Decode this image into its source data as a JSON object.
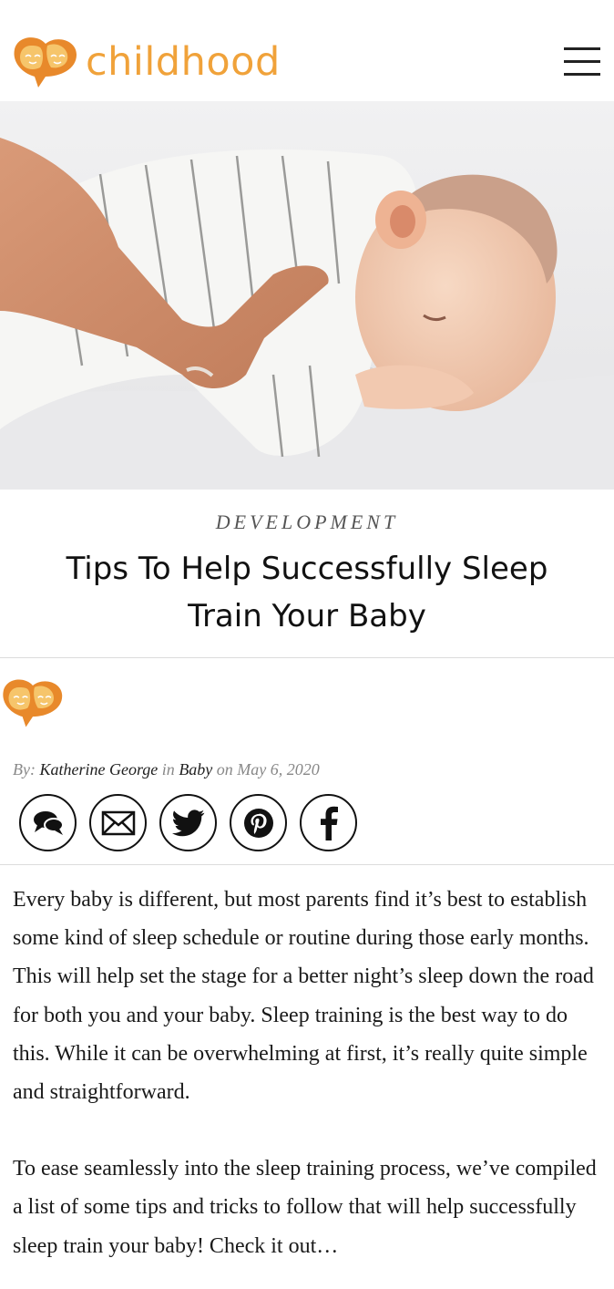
{
  "header": {
    "logo_text": "childhood",
    "menu_icon": "hamburger-menu-icon"
  },
  "hero": {
    "image_subject": "sleeping-baby-photo"
  },
  "article": {
    "category": "DEVELOPMENT",
    "title": "Tips To Help Successfully Sleep Train Your Baby",
    "byline": {
      "by_label": "By:",
      "author": "Katherine George",
      "in_label": "in",
      "section": "Baby",
      "on_label": "on",
      "date": "May 6, 2020"
    },
    "share": [
      {
        "icon": "comment-icon"
      },
      {
        "icon": "email-icon"
      },
      {
        "icon": "twitter-icon"
      },
      {
        "icon": "pinterest-icon"
      },
      {
        "icon": "facebook-icon"
      }
    ],
    "paragraphs": [
      "Every baby is different, but most parents find it’s best to establish some kind of sleep schedule or routine during those early months. This will help set the stage for a better night’s sleep down the road for both you and your baby. Sleep training is the best way to do this. While it can be overwhelming at first, it’s really quite simple and straightforward.",
      "To ease seamlessly into the sleep training process, we’ve compiled a list of some tips and tricks to follow that will help successfully sleep train your baby! Check it out…"
    ]
  },
  "colors": {
    "brand_orange": "#f0a23a",
    "brand_orange_dark": "#e8892b",
    "text": "#111111",
    "muted": "#888888"
  }
}
